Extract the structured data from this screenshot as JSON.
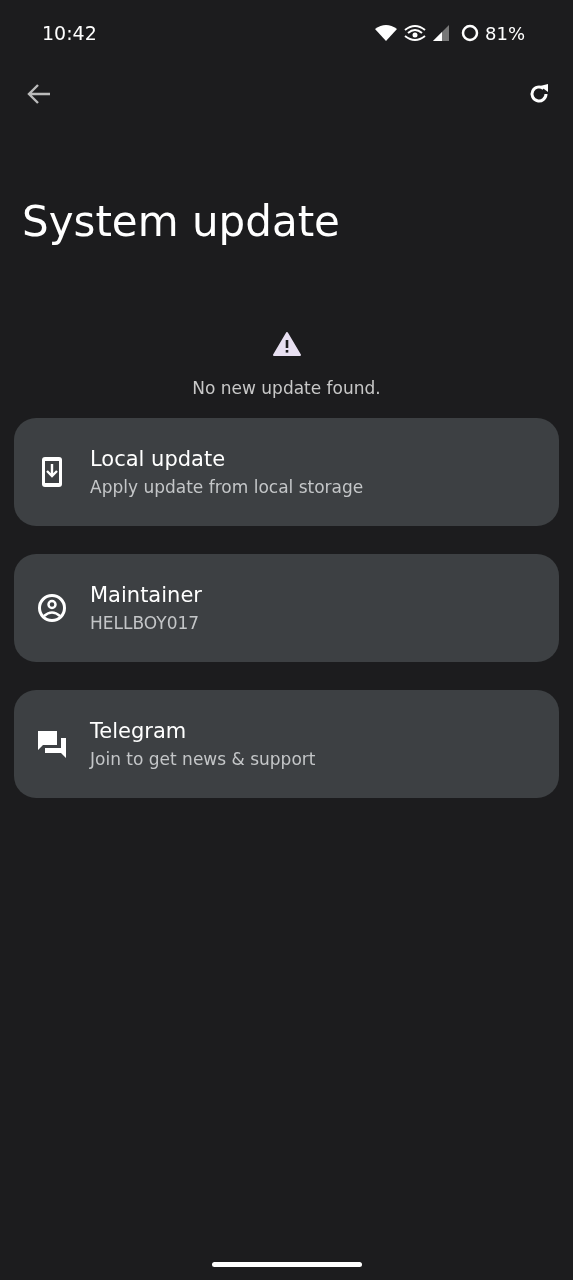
{
  "status_bar": {
    "time": "10:42",
    "battery": "81%"
  },
  "title": "System update",
  "status_message": "No new update found.",
  "cards": [
    {
      "kind": "download",
      "title": "Local update",
      "subtitle": "Apply update from local storage"
    },
    {
      "kind": "person",
      "title": "Maintainer",
      "subtitle": "HELLBOY017"
    },
    {
      "kind": "chat",
      "title": "Telegram",
      "subtitle": "Join to get news & support"
    }
  ]
}
